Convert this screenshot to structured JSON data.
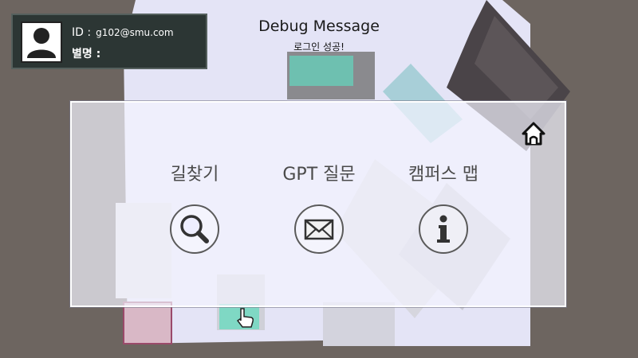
{
  "debug": {
    "title": "Debug Message",
    "message": "로그인 성공!"
  },
  "profile": {
    "id_label": "ID :",
    "id_value": "g102@smu.com",
    "nickname_label": "별명 :"
  },
  "menu": [
    {
      "label": "길찾기",
      "icon": "search-icon"
    },
    {
      "label": "GPT 질문",
      "icon": "mail-icon"
    },
    {
      "label": "캠퍼스 맵",
      "icon": "info-icon"
    }
  ],
  "colors": {
    "panel": "#f4f4ff",
    "map_ground": "#e4e4f6",
    "background": "#6d6560",
    "profile_bg": "#2c3634"
  }
}
